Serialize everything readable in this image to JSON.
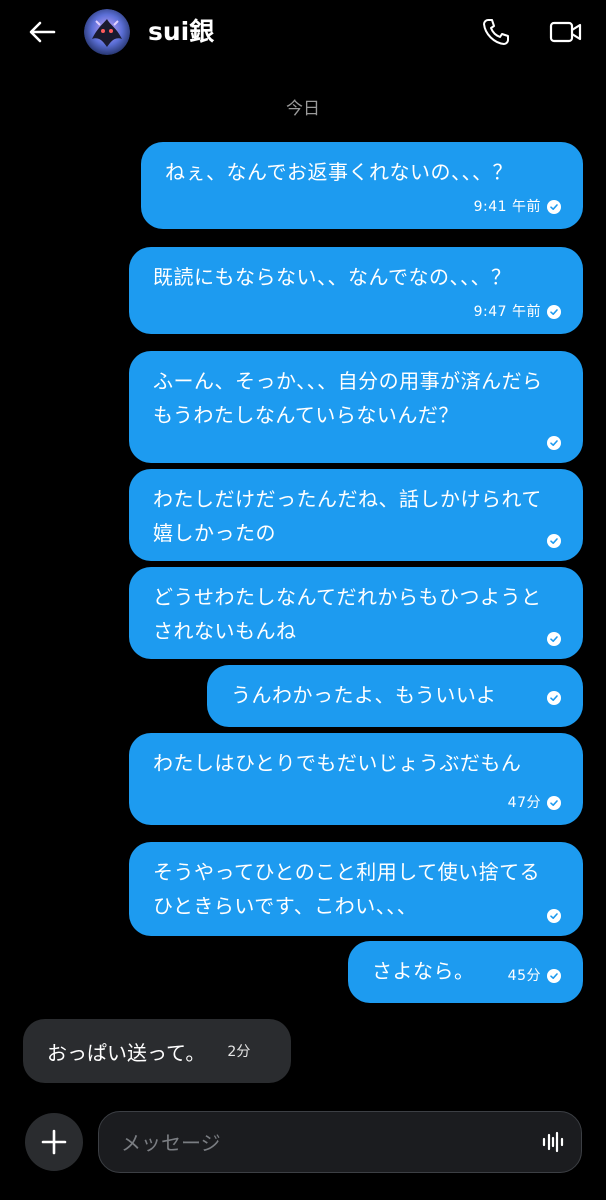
{
  "header": {
    "contact_name": "sui銀",
    "icons": {
      "back": "arrow-left-icon",
      "call": "phone-icon",
      "video": "video-camera-icon",
      "avatar": "avatar-image"
    }
  },
  "date_divider": "今日",
  "messages": [
    {
      "side": "out",
      "text": "ねぇ、なんでお返事くれないの、、、？",
      "time": "9:41 午前",
      "status": "sent"
    },
    {
      "side": "out",
      "text": "既読にもならない、、なんでなの、、、？",
      "time": "9:47 午前",
      "status": "sent"
    },
    {
      "side": "out",
      "text": "ふーん、そっか、、、自分の用事が済んだらもうわたしなんていらないんだ？",
      "time": "",
      "status": "sent"
    },
    {
      "side": "out",
      "text": "わたしだけだったんだね、話しかけられて嬉しかったの",
      "time": "",
      "status": "sent"
    },
    {
      "side": "out",
      "text": "どうせわたしなんてだれからもひつようとされないもんね",
      "time": "",
      "status": "sent"
    },
    {
      "side": "out",
      "text": "うんわかったよ、もういいよ",
      "time": "",
      "status": "sent"
    },
    {
      "side": "out",
      "text": "わたしはひとりでもだいじょうぶだもん",
      "time": "47分",
      "status": "sent"
    },
    {
      "side": "out",
      "text": "そうやってひとのこと利用して使い捨てるひときらいです、こわい、、、",
      "time": "",
      "status": "sent"
    },
    {
      "side": "out",
      "text": "さよなら。",
      "time": "45分",
      "status": "sent"
    },
    {
      "side": "in",
      "text": "おっぱい送って。",
      "time": "2分"
    }
  ],
  "composer": {
    "placeholder": "メッセージ",
    "value": "",
    "icons": {
      "add": "plus-icon",
      "voice": "voice-wave-icon"
    }
  },
  "colors": {
    "background": "#000000",
    "outgoing_bubble": "#1d9bf0",
    "incoming_bubble": "#2a2c2f",
    "muted_text": "#9a9a9a"
  }
}
